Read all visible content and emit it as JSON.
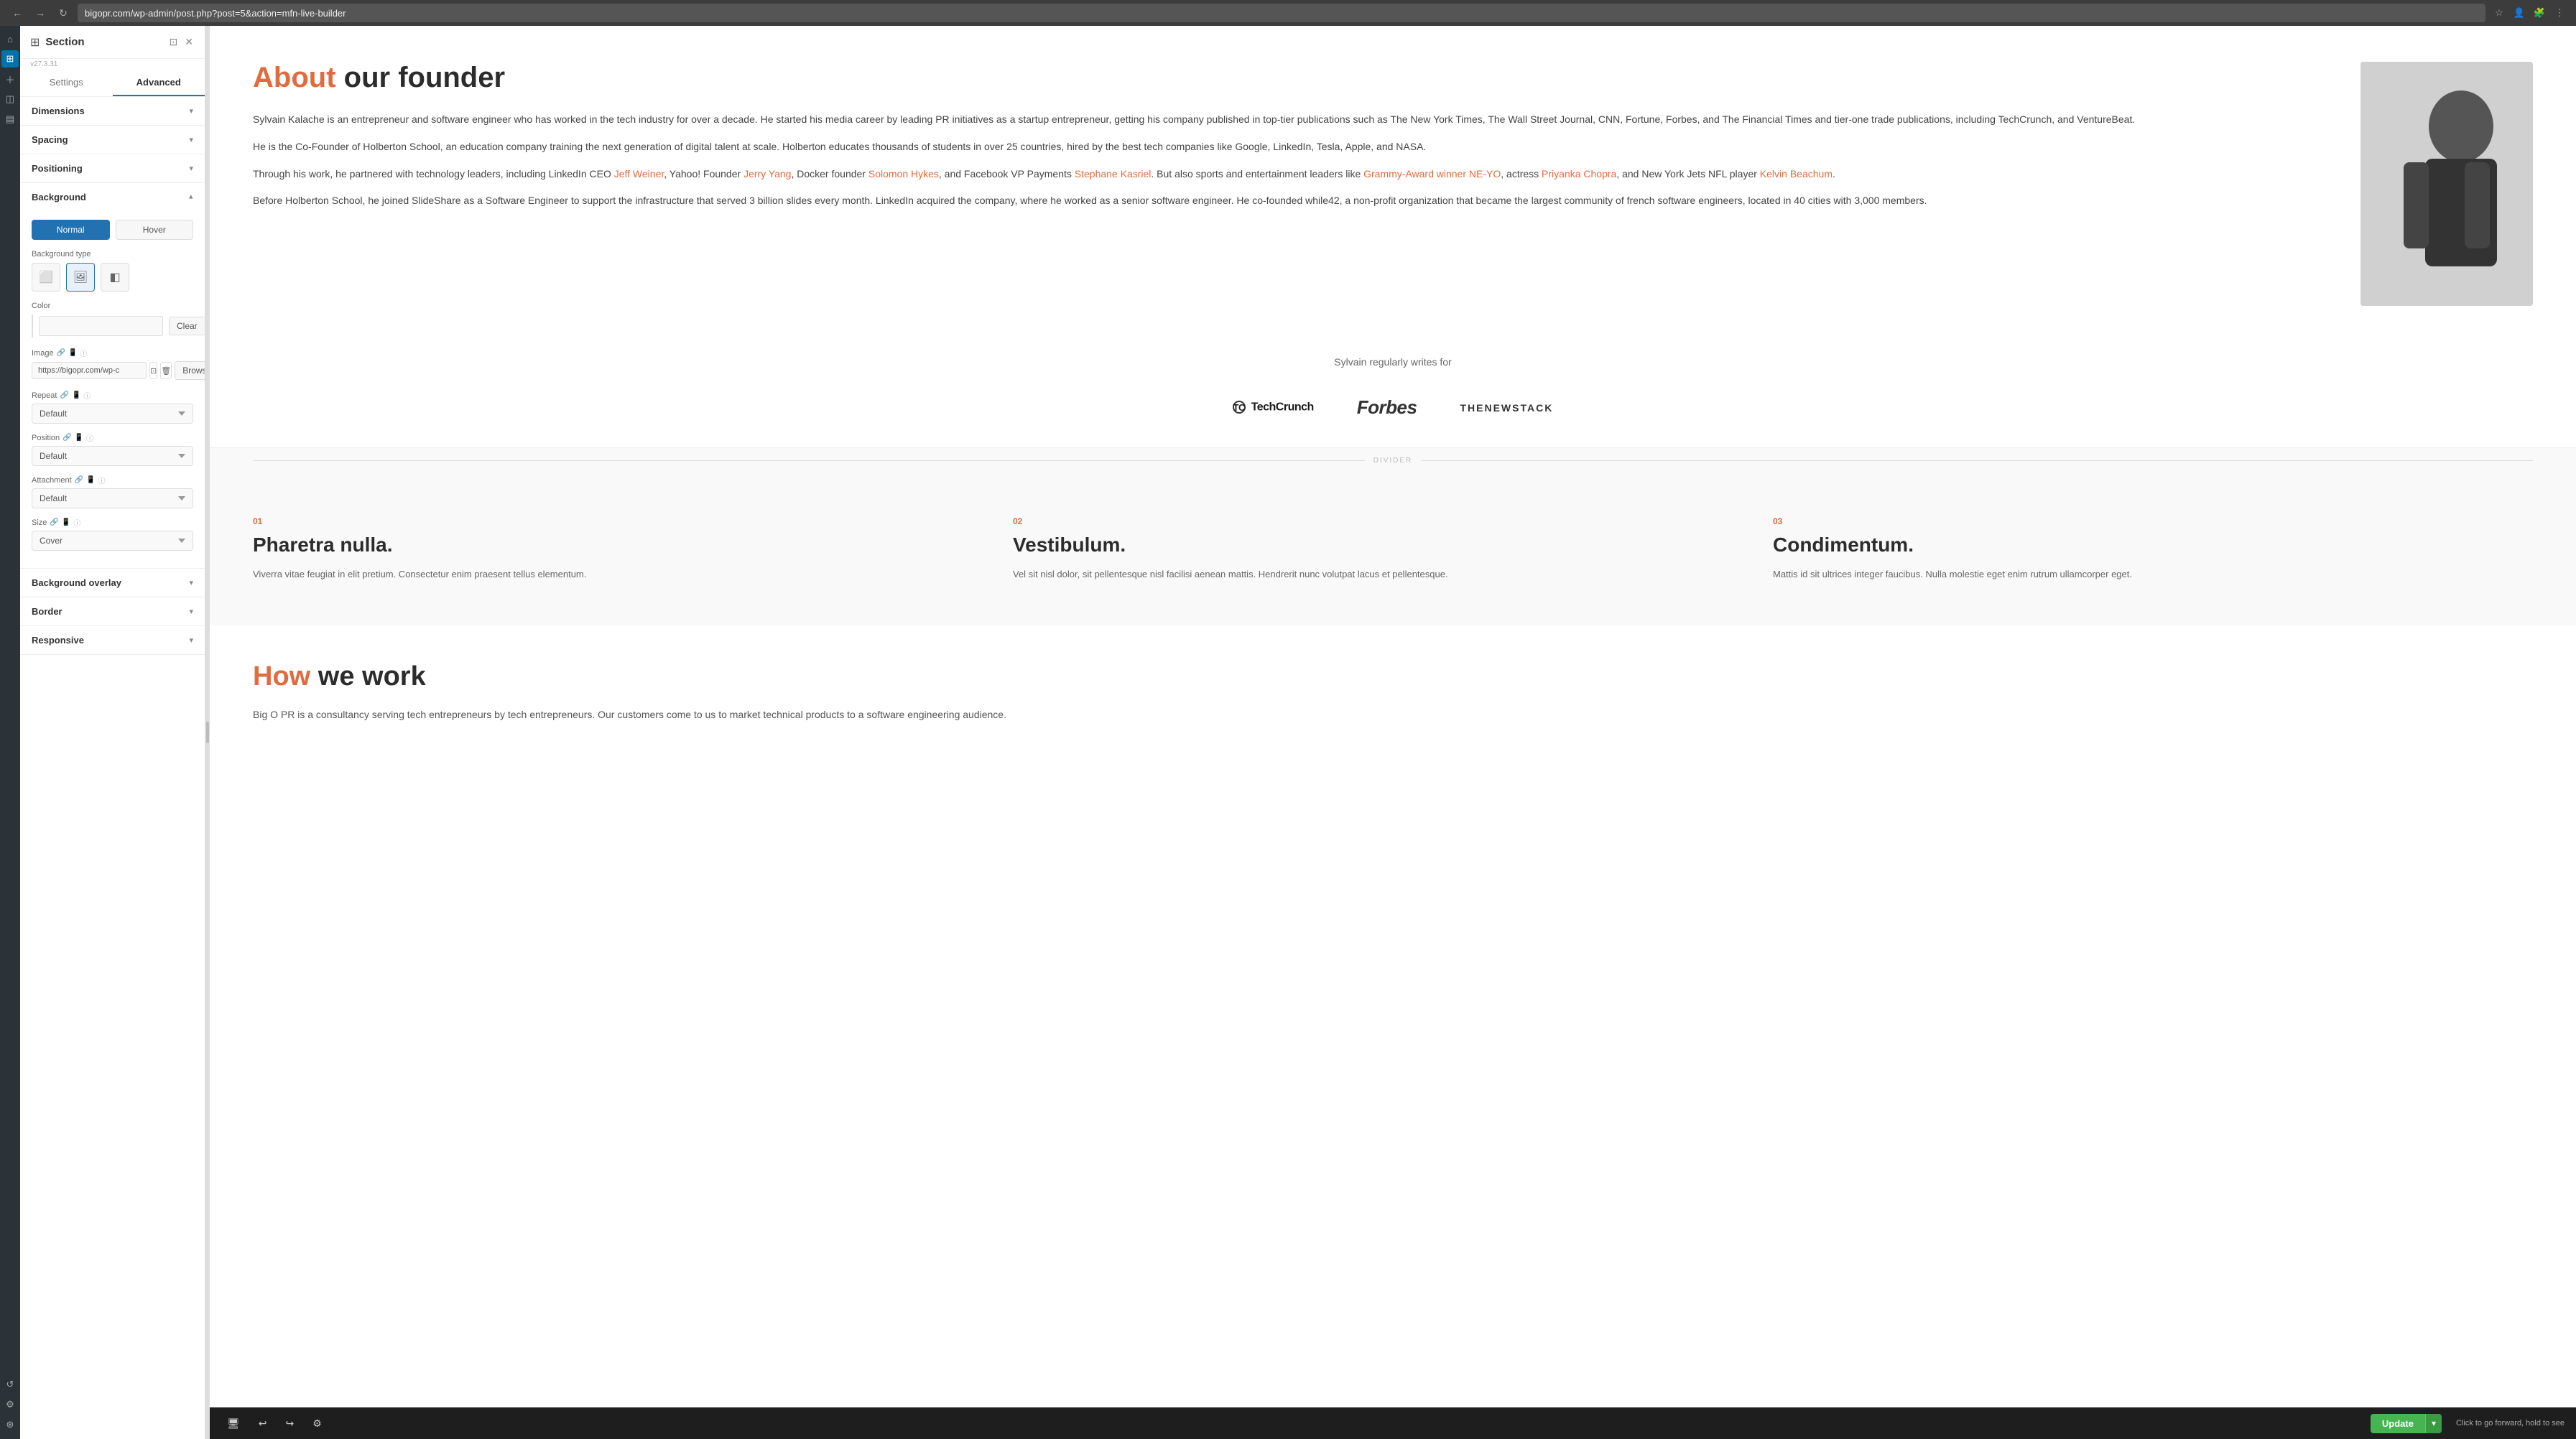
{
  "browser": {
    "url": "bigopr.com/wp-admin/post.php?post=5&action=mfn-live-builder",
    "back_label": "←",
    "forward_label": "→",
    "reload_label": "↻"
  },
  "panel": {
    "title": "Section",
    "version": "v27.3.31",
    "tab_settings": "Settings",
    "tab_advanced": "Advanced",
    "active_tab": "Advanced",
    "dimensions_label": "Dimensions",
    "spacing_label": "Spacing",
    "positioning_label": "Positioning",
    "background_label": "Background",
    "background_type_label": "Background type",
    "normal_label": "Normal",
    "hover_label": "Hover",
    "color_label": "Color",
    "clear_label": "Clear",
    "image_label": "Image",
    "image_url": "https://bigopr.com/wp-c",
    "repeat_label": "Repeat",
    "repeat_default": "Default",
    "position_label": "Position",
    "position_default": "Default",
    "attachment_label": "Attachment",
    "attachment_default": "Default",
    "size_label": "Size",
    "size_cover": "Cover",
    "background_overlay_label": "Background overlay",
    "border_label": "Border",
    "responsive_label": "Responsive",
    "browse_label": "Browse"
  },
  "content": {
    "about_title_normal": "our founder",
    "about_title_highlight": "About",
    "para1": "Sylvain Kalache is an entrepreneur and software engineer who has worked in the tech industry for over a decade. He started his media career by leading PR initiatives as a startup entrepreneur, getting his company published in top-tier publications such as The New York Times, The Wall Street Journal, CNN, Fortune, Forbes, and The Financial Times and tier-one trade publications, including TechCrunch, and VentureBeat.",
    "para2": "He is the Co-Founder of Holberton School, an education company training the next generation of digital talent at scale. Holberton educates thousands of students in over 25 countries, hired by the best tech companies like Google, LinkedIn, Tesla, Apple, and NASA.",
    "para3_prefix": "Through his work, he partnered with technology leaders, including LinkedIn CEO ",
    "jeff_weiner": "Jeff Weiner",
    "para3_mid1": ", Yahoo! Founder ",
    "jerry_yang": "Jerry Yang",
    "para3_mid2": ", Docker founder ",
    "solomon_hykes": "Solomon Hykes",
    "para3_mid3": ", and Facebook VP Payments ",
    "stephane_kasriel": "Stephane Kasriel",
    "para3_mid4": ". But also sports and entertainment leaders like ",
    "grammy": "Grammy-Award winner NE-YO",
    "para3_mid5": ",  actress ",
    "priyanka_chopra": "Priyanka Chopra",
    "para3_mid6": ", and New York Jets NFL player ",
    "kelvin_beachum": "Kelvin Beachum",
    "para3_end": ".",
    "para4": "Before Holberton School, he joined SlideShare as a Software Engineer to support the infrastructure that served 3 billion slides every month. LinkedIn acquired the company, where he worked as a senior software engineer. He co-founded while42, a non-profit organization that became the largest community of french software engineers, located in 40 cities with 3,000 members.",
    "writes_for": "Sylvain regularly writes for",
    "brand1": "TechCrunch",
    "brand2": "Forbes",
    "brand3": "THENEWSTACK",
    "divider_label": "DIVIDER",
    "feature1_num": "01",
    "feature1_title": "Pharetra nulla.",
    "feature1_body": "Viverra vitae feugiat in elit pretium. Consectetur enim praesent tellus elementum.",
    "feature2_num": "02",
    "feature2_title": "Vestibulum.",
    "feature2_body": "Vel sit nisl dolor, sit pellentesque nisl facilisi aenean mattis. Hendrerit nunc volutpat lacus et pellentesque.",
    "feature3_num": "03",
    "feature3_title": "Condimentum.",
    "feature3_body": "Mattis id sit ultrices integer faucibus. Nulla molestie eget enim rutrum ullamcorper eget.",
    "how_title_highlight": "How",
    "how_title_normal": " we work",
    "how_body": "Big O PR is a consultancy serving tech entrepreneurs by tech entrepreneurs. Our customers come to us to market technical products to a software engineering audience.",
    "tooltip": "Click to go forward, hold to see"
  },
  "toolbar": {
    "update_label": "Update",
    "arrow_label": "▾",
    "device_desktop": "🖥",
    "undo_label": "↩",
    "redo_label": "↪",
    "settings_label": "⚙"
  }
}
